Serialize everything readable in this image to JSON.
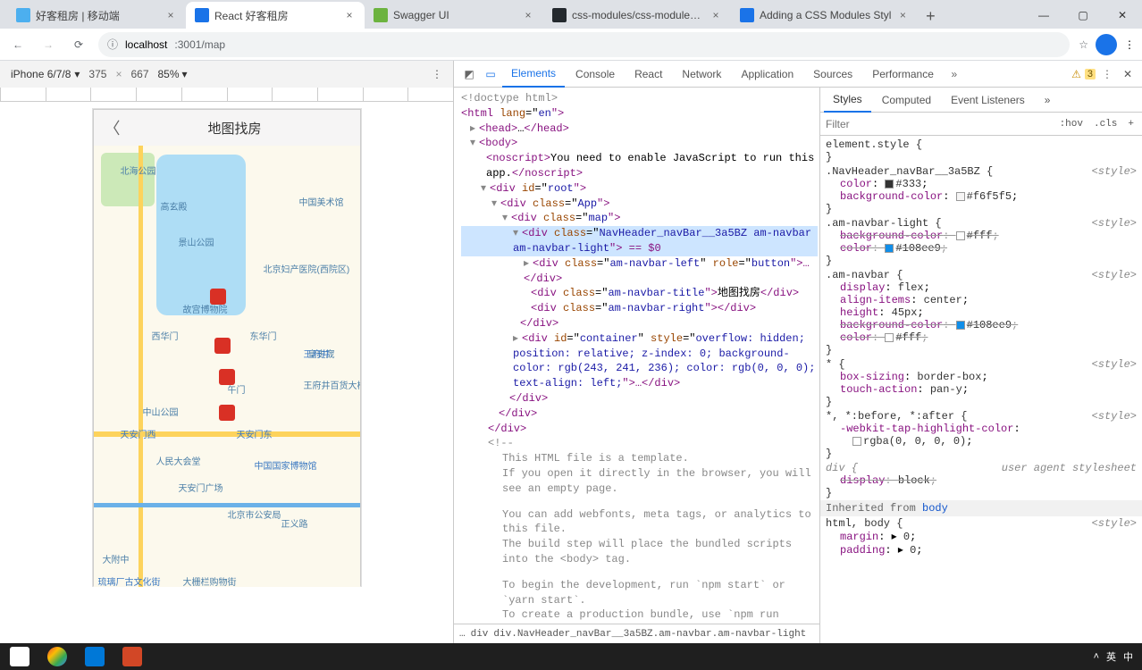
{
  "browser": {
    "tabs": [
      {
        "title": "好客租房 | 移动端",
        "favColor": "#4cafef"
      },
      {
        "title": "React 好客租房",
        "favColor": "#1a73e8"
      },
      {
        "title": "Swagger UI",
        "favColor": "#6cb33f"
      },
      {
        "title": "css-modules/css-modules: D",
        "favColor": "#24292e"
      },
      {
        "title": "Adding a CSS Modules Styl",
        "favColor": "#1a73e8"
      }
    ],
    "activeTab": 1,
    "url_host": "localhost",
    "url_port_path": ":3001/map"
  },
  "device": {
    "name": "iPhone 6/7/8",
    "width": "375",
    "height": "667",
    "zoom": "85%"
  },
  "phone": {
    "title": "地图找房",
    "pois": {
      "p1": "北海公园",
      "p2": "高玄殿",
      "p3": "中国美术馆",
      "p4": "景山公园",
      "p5": "北京妇产医院(西院区)",
      "p6": "故宫博物院",
      "p7": "皇史宬",
      "p8": "西华门",
      "p9": "东华门",
      "p10": "王府井",
      "p11": "午门",
      "p12": "中山公园",
      "p13": "天安门东",
      "p14": "天安门西",
      "p15": "人民大会堂",
      "p16": "天安门广场",
      "p17": "中国国家博物馆",
      "p18": "北京市公安局",
      "p19": "正义路",
      "p20": "大附中",
      "p21": "琉璃厂古文化街",
      "p22": "大栅栏购物街",
      "p23": "王府井百货大楼"
    }
  },
  "devtools": {
    "tabs": [
      "Elements",
      "Console",
      "React",
      "Network",
      "Application",
      "Sources",
      "Performance"
    ],
    "activeTab": 0,
    "warn_count": "3",
    "dom": {
      "l1": "<!doctype html>",
      "l2a": "<html ",
      "l2b": "lang",
      "l2c": "=\"",
      "l2d": "en",
      "l2e": "\">",
      "l3a": "<head>",
      "l3b": "…",
      "l3c": "</head>",
      "l4": "<body>",
      "l5a": "<noscript>",
      "l5b": "You need to enable JavaScript to run this app.",
      "l5c": "</noscript>",
      "l6a": "<div ",
      "l6b": "id",
      "l6c": "=\"",
      "l6d": "root",
      "l6e": "\">",
      "l7a": "<div ",
      "l7b": "class",
      "l7c": "=\"",
      "l7d": "App",
      "l7e": "\">",
      "l8a": "<div ",
      "l8b": "class",
      "l8c": "=\"",
      "l8d": "map",
      "l8e": "\">",
      "l9a": "<div ",
      "l9b": "class",
      "l9c": "=\"",
      "l9d": "NavHeader_navBar__3a5BZ am-navbar am-navbar-light",
      "l9e": "\"> == $0",
      "l10a": "<div ",
      "l10b": "class",
      "l10c": "=\"",
      "l10d": "am-navbar-left",
      "l10e": "\" ",
      "l10f": "role",
      "l10g": "=\"",
      "l10h": "button",
      "l10i": "\">…</div>",
      "l11a": "<div ",
      "l11b": "class",
      "l11c": "=\"",
      "l11d": "am-navbar-title",
      "l11e": "\">",
      "l11f": "地图找房",
      "l11g": "</div>",
      "l12a": "<div ",
      "l12b": "class",
      "l12c": "=\"",
      "l12d": "am-navbar-right",
      "l12e": "\"></div>",
      "l13": "</div>",
      "l14a": "<div ",
      "l14b": "id",
      "l14c": "=\"",
      "l14d": "container",
      "l14e": "\" ",
      "l14f": "style",
      "l14g": "=\"",
      "l14h": "overflow: hidden; position: relative; z-index: 0; background-color: rgb(243, 241, 236); color: rgb(0, 0, 0); text-align: left;",
      "l14i": "\">…</div>",
      "l15": "</div>",
      "l16": "</div>",
      "l17": "</div>",
      "c1": "<!--",
      "c2": "This HTML file is a template.",
      "c3": "If you open it directly in the browser, you will see an empty page.",
      "c4": "You can add webfonts, meta tags, or analytics to this file.",
      "c5": "The build step will place the bundled scripts into the <body> tag.",
      "c6": "To begin the development, run `npm start` or `yarn start`.",
      "c7": "To create a production bundle, use `npm run build` or `yarn build`."
    },
    "crumbs": {
      "more": "…",
      "c1": "div",
      "c2": "div.NavHeader_navBar__3a5BZ.am-navbar.am-navbar-light"
    },
    "styles": {
      "tabs": [
        "Styles",
        "Computed",
        "Event Listeners"
      ],
      "filter_ph": "Filter",
      "hov": ":hov",
      "cls": ".cls",
      "r1_sel": "element.style {",
      "r2_sel": ".NavHeader_navBar__3a5BZ {",
      "r2_src": "<style>",
      "r2_p1n": "color",
      "r2_p1v": "#333",
      "r2_p1s": "#333333",
      "r2_p2n": "background-color",
      "r2_p2v": "#f6f5f5",
      "r2_p2s": "#f6f5f5",
      "r3_sel": ".am-navbar-light {",
      "r3_src": "<style>",
      "r3_p1n": "background-color",
      "r3_p1v": "#fff",
      "r3_p1s": "#ffffff",
      "r3_p2n": "color",
      "r3_p2v": "#108ee9",
      "r3_p2s": "#108ee9",
      "r4_sel": ".am-navbar {",
      "r4_src": "<style>",
      "r4_p1n": "display",
      "r4_p1v": "flex",
      "r4_p2n": "align-items",
      "r4_p2v": "center",
      "r4_p3n": "height",
      "r4_p3v": "45px",
      "r4_p4n": "background-color",
      "r4_p4v": "#108ee9",
      "r4_p4s": "#108ee9",
      "r4_p5n": "color",
      "r4_p5v": "#fff",
      "r4_p5s": "#ffffff",
      "r5_sel": "* {",
      "r5_src": "<style>",
      "r5_p1n": "box-sizing",
      "r5_p1v": "border-box",
      "r5_p2n": "touch-action",
      "r5_p2v": "pan-y",
      "r6_sel": "*, *:before, *:after {",
      "r6_src": "<style>",
      "r6_p1n": "-webkit-tap-highlight-color",
      "r6_p1v": "rgba(0, 0, 0, 0)",
      "r7_sel": "div {",
      "r7_src": "user agent stylesheet",
      "r7_p1n": "display",
      "r7_p1v": "block",
      "inh_label": "Inherited from ",
      "inh_from": "body",
      "r8_sel": "html, body {",
      "r8_src": "<style>",
      "r8_p1n": "margin",
      "r8_p1v": "0",
      "r8_p2n": "padding",
      "r8_p2v": "0"
    }
  },
  "taskbar": {
    "ime1": "英",
    "ime2": "中"
  }
}
